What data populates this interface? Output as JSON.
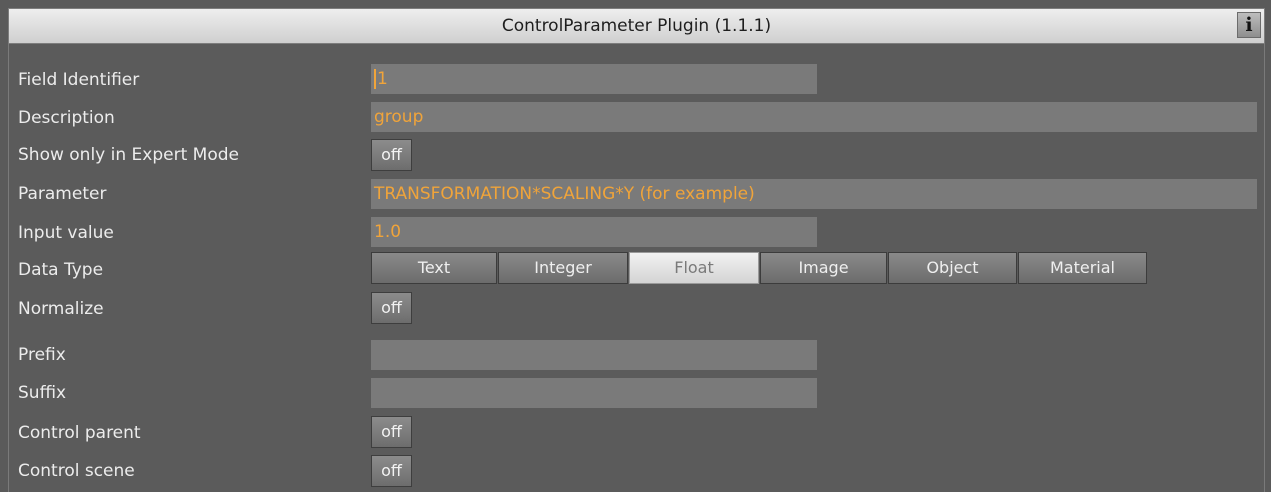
{
  "window": {
    "title": "ControlParameter Plugin (1.1.1)",
    "info_label": "i"
  },
  "fields": {
    "field_identifier": {
      "label": "Field Identifier",
      "value": "1"
    },
    "description": {
      "label": "Description",
      "value": "group"
    },
    "expert_mode": {
      "label": "Show only in Expert Mode",
      "value": "off"
    },
    "parameter": {
      "label": "Parameter",
      "value": "TRANSFORMATION*SCALING*Y (for example)"
    },
    "input_value": {
      "label": "Input value",
      "value": "1.0"
    },
    "data_type": {
      "label": "Data Type",
      "options": [
        "Text",
        "Integer",
        "Float",
        "Image",
        "Object",
        "Material"
      ],
      "selected": "Float"
    },
    "normalize": {
      "label": "Normalize",
      "value": "off"
    },
    "prefix": {
      "label": "Prefix",
      "value": ""
    },
    "suffix": {
      "label": "Suffix",
      "value": ""
    },
    "control_parent": {
      "label": "Control parent",
      "value": "off"
    },
    "control_scene": {
      "label": "Control scene",
      "value": "off"
    }
  },
  "colors": {
    "value_text": "#f0a43a",
    "panel_bg": "#5a5a5a",
    "field_bg": "#7a7a7a"
  }
}
